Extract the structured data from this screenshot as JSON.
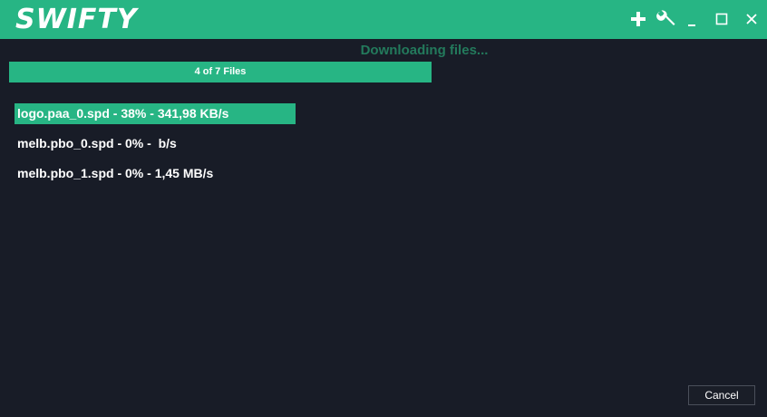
{
  "app": {
    "title": "SWIFTY"
  },
  "titlebar": {
    "buttons": [
      {
        "icon": "plus-icon"
      },
      {
        "icon": "wrench-icon"
      },
      {
        "icon": "minimize-icon"
      },
      {
        "icon": "maximize-icon"
      },
      {
        "icon": "close-icon"
      }
    ]
  },
  "download": {
    "status": "Downloading files...",
    "progress_label": "4 of 7 Files",
    "progress_fraction": 1.0,
    "files": [
      {
        "text": "logo.paa_0.spd - 38% - 341,98 KB/s",
        "active": true
      },
      {
        "text": "melb.pbo_0.spd - 0% -  b/s",
        "active": false
      },
      {
        "text": "melb.pbo_1.spd - 0% - 1,45 MB/s",
        "active": false
      }
    ]
  },
  "footer": {
    "cancel_label": "Cancel"
  },
  "colors": {
    "accent": "#27b584",
    "background": "#181c27",
    "status_text": "#237a5c"
  }
}
